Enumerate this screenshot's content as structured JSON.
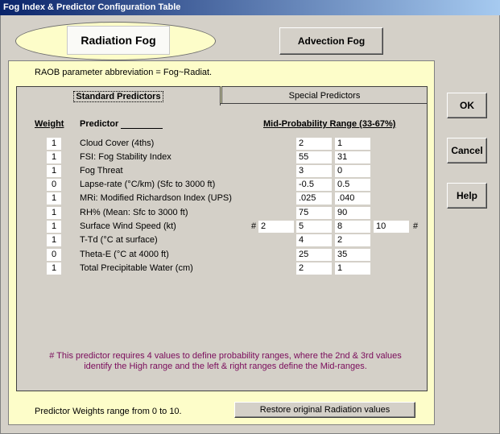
{
  "window": {
    "title": "Fog Index & Predictor Configuration Table"
  },
  "fog_types": {
    "radiation": "Radiation Fog",
    "advection": "Advection Fog"
  },
  "raob_text": "RAOB parameter abbreviation = Fog~Radiat.",
  "tabs": {
    "standard": "Standard Predictors",
    "special": "Special Predictors"
  },
  "headers": {
    "weight": "Weight",
    "predictor": "Predictor",
    "range": "Mid-Probability Range (33-67%)"
  },
  "predictors": [
    {
      "weight": "1",
      "name": "Cloud Cover (4ths)",
      "v1": "2",
      "v2": "1"
    },
    {
      "weight": "1",
      "name": "FSI: Fog Stability Index",
      "v1": "55",
      "v2": "31"
    },
    {
      "weight": "1",
      "name": "Fog Threat",
      "v1": "3",
      "v2": "0"
    },
    {
      "weight": "0",
      "name": "Lapse-rate (°C/km) (Sfc to 3000 ft)",
      "v1": "-0.5",
      "v2": "0.5"
    },
    {
      "weight": "1",
      "name": "MRi: Modified Richardson Index (UPS)",
      "v1": ".025",
      "v2": ".040"
    },
    {
      "weight": "1",
      "name": "RH% (Mean: Sfc to 3000 ft)",
      "v1": "75",
      "v2": "90"
    },
    {
      "weight": "1",
      "name": "Surface Wind Speed (kt)",
      "v0": "2",
      "v1": "5",
      "v2": "8",
      "v3": "10"
    },
    {
      "weight": "1",
      "name": "T-Td (°C at surface)",
      "v1": "4",
      "v2": "2"
    },
    {
      "weight": "0",
      "name": "Theta-E (°C at 4000 ft)",
      "v1": "25",
      "v2": "35"
    },
    {
      "weight": "1",
      "name": "Total Precipitable Water (cm)",
      "v1": "2",
      "v2": "1"
    }
  ],
  "hash_symbol": "#",
  "note": {
    "line1": "# This predictor requires 4 values to define probability ranges, where the 2nd & 3rd values",
    "line2": "identify the High range and the left & right ranges define the Mid-ranges."
  },
  "footer": {
    "weights_text": "Predictor Weights range from 0 to 10.",
    "restore_label": "Restore original Radiation values"
  },
  "buttons": {
    "ok": "OK",
    "cancel": "Cancel",
    "help": "Help"
  }
}
